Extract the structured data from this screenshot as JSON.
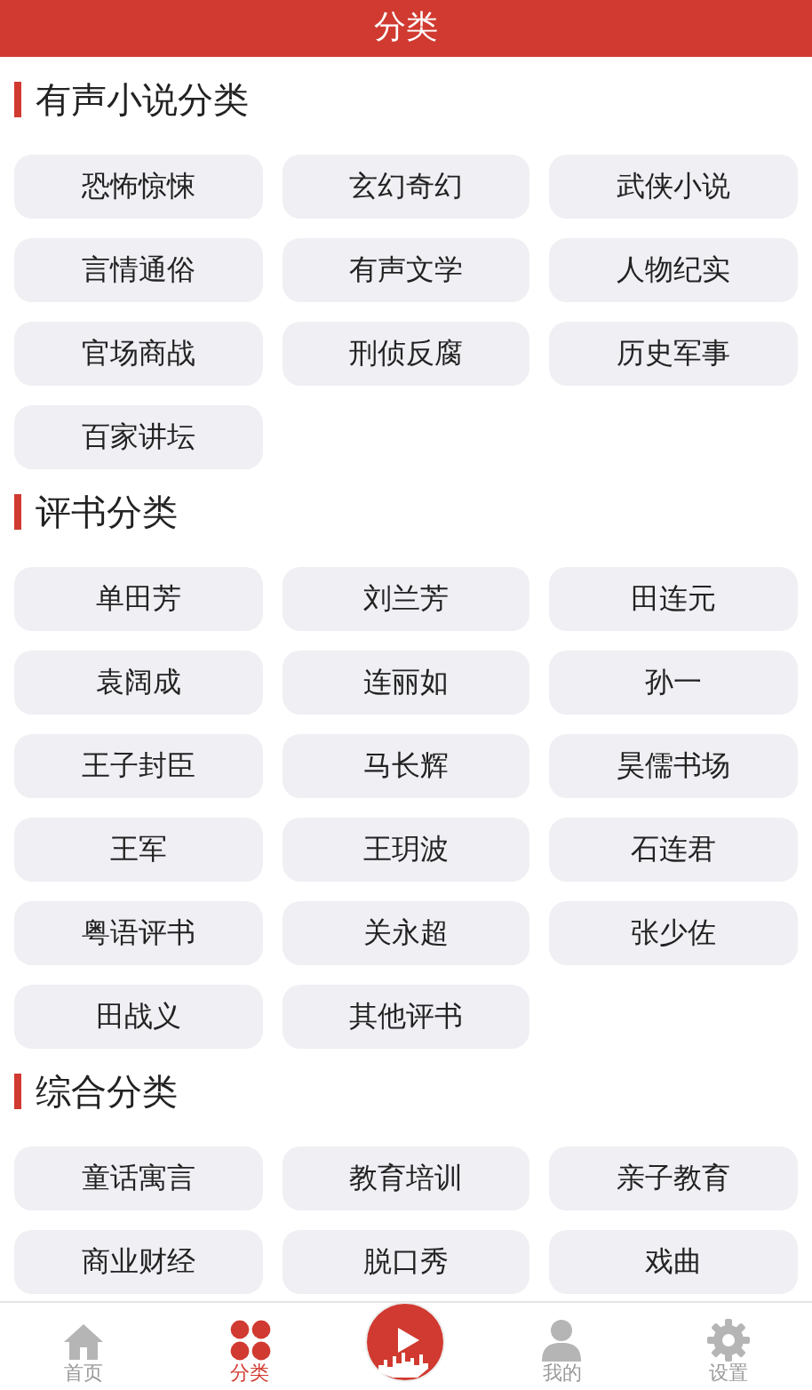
{
  "header": {
    "title": "分类"
  },
  "sections": [
    {
      "title": "有声小说分类",
      "items": [
        "恐怖惊悚",
        "玄幻奇幻",
        "武侠小说",
        "言情通俗",
        "有声文学",
        "人物纪实",
        "官场商战",
        "刑侦反腐",
        "历史军事",
        "百家讲坛"
      ]
    },
    {
      "title": "评书分类",
      "items": [
        "单田芳",
        "刘兰芳",
        "田连元",
        "袁阔成",
        "连丽如",
        "孙一",
        "王子封臣",
        "马长辉",
        "昊儒书场",
        "王军",
        "王玥波",
        "石连君",
        "粤语评书",
        "关永超",
        "张少佐",
        "田战义",
        "其他评书"
      ]
    },
    {
      "title": "综合分类",
      "items": [
        "童话寓言",
        "教育培训",
        "亲子教育",
        "商业财经",
        "脱口秀",
        "戏曲"
      ]
    }
  ],
  "tabbar": [
    {
      "kind": "home",
      "label": "首页",
      "selected": false
    },
    {
      "kind": "grid",
      "label": "分类",
      "selected": true
    },
    {
      "kind": "logo"
    },
    {
      "kind": "user",
      "label": "我的",
      "selected": false
    },
    {
      "kind": "gear",
      "label": "设置",
      "selected": false
    }
  ]
}
